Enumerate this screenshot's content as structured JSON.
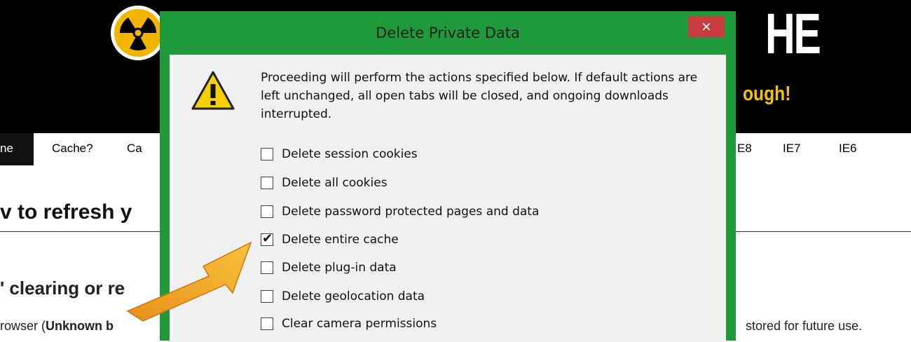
{
  "site": {
    "header_fragment": "HE",
    "tagline": "ough!",
    "nav": [
      "ne",
      "Cache?",
      "Ca",
      "E8",
      "IE7",
      "IE6"
    ],
    "heading": "v to refresh y",
    "subheading": "' clearing or re",
    "paragraph_start": "rowser (",
    "paragraph_bold": "Unknown b",
    "paragraph_end": "stored for future use."
  },
  "dialog": {
    "title": "Delete Private Data",
    "close_label": "×",
    "message": "Proceeding will perform the actions specified below. If default actions are left unchanged, all open tabs will be closed, and ongoing downloads interrupted.",
    "icon": "warning-icon",
    "options": [
      {
        "label": "Delete session cookies",
        "checked": false
      },
      {
        "label": "Delete all cookies",
        "checked": false
      },
      {
        "label": "Delete password protected pages and data",
        "checked": false
      },
      {
        "label": "Delete entire cache",
        "checked": true
      },
      {
        "label": "Delete plug-in data",
        "checked": false
      },
      {
        "label": "Delete geolocation data",
        "checked": false
      },
      {
        "label": "Clear camera permissions",
        "checked": false
      }
    ],
    "checkmark": "✔"
  },
  "colors": {
    "dialog_frame": "#1f9a3a",
    "close_button": "#c73d3d",
    "arrow": "#f2a51f",
    "warning_fill": "#f5d000",
    "tagline": "#f5c400"
  }
}
